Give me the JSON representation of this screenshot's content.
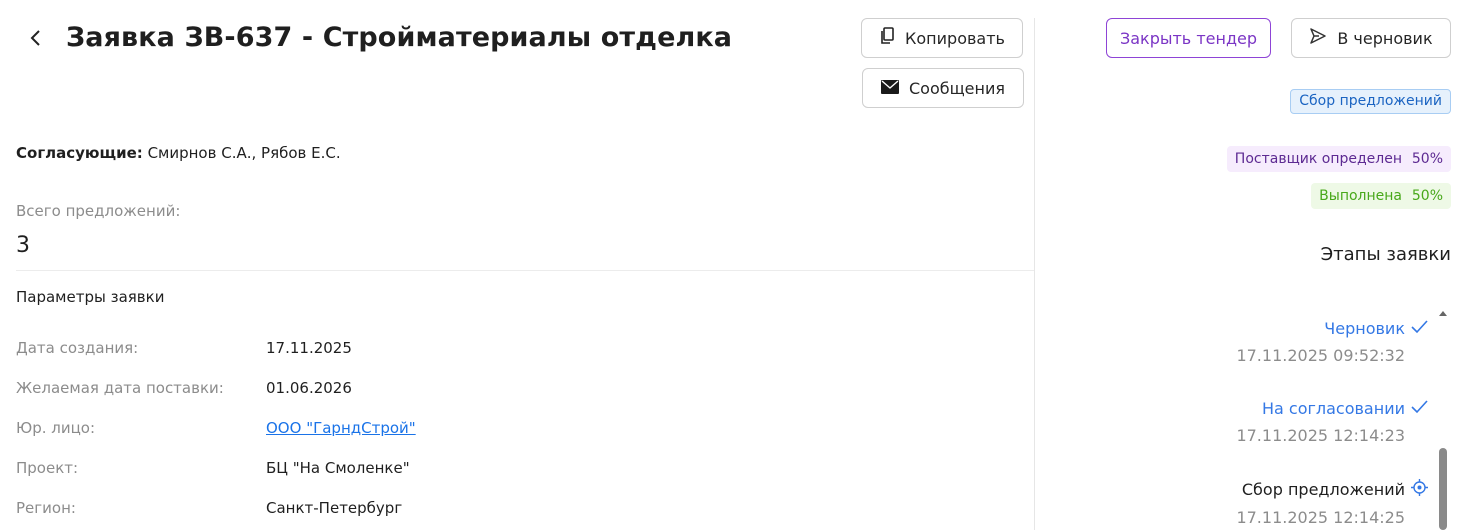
{
  "header": {
    "title": "Заявка ЗВ-637 - Стройматериалы отделка",
    "copy_label": "Копировать",
    "messages_label": "Сообщения"
  },
  "approvers": {
    "label": "Согласующие:",
    "value": "Смирнов С.А., Рябов Е.С."
  },
  "total_offers": {
    "label": "Всего предложений:",
    "value": "3"
  },
  "params": {
    "title": "Параметры заявки",
    "rows": [
      {
        "label": "Дата создания:",
        "value": "17.11.2025"
      },
      {
        "label": "Желаемая дата поставки:",
        "value": "01.06.2026"
      },
      {
        "label": "Юр. лицо:",
        "value": "ООО \"ГарндСтрой\""
      },
      {
        "label": "Проект:",
        "value": "БЦ \"На Смоленке\""
      },
      {
        "label": "Регион:",
        "value": "Санкт-Петербург"
      }
    ]
  },
  "actions": {
    "close_tender_label": "Закрыть тендер",
    "to_draft_label": "В черновик"
  },
  "status_tag": "Сбор предложений",
  "progress": [
    {
      "label": "Поставщик определен",
      "percent": "50%"
    },
    {
      "label": "Выполнена",
      "percent": "50%"
    }
  ],
  "stages": {
    "title": "Этапы заявки",
    "items": [
      {
        "name": "Черновик",
        "date": "17.11.2025 09:52:32",
        "state": "done"
      },
      {
        "name": "На согласовании",
        "date": "17.11.2025 12:14:23",
        "state": "done"
      },
      {
        "name": "Сбор предложений",
        "date": "17.11.2025 12:14:25",
        "state": "current"
      }
    ]
  },
  "colors": {
    "accent_purple": "#7b35c5",
    "link_blue": "#1a73e8",
    "stage_blue": "#3478e5",
    "status_blue_bg": "#e6f1fc",
    "supplier_bg": "#f6ecfd",
    "done_green": "#48a81a"
  },
  "icons": {
    "back": "chevron-left-icon",
    "copy": "copy-icon",
    "messages": "envelope-icon",
    "to_draft": "send-icon",
    "stage_done": "check-icon",
    "stage_current": "target-icon"
  }
}
